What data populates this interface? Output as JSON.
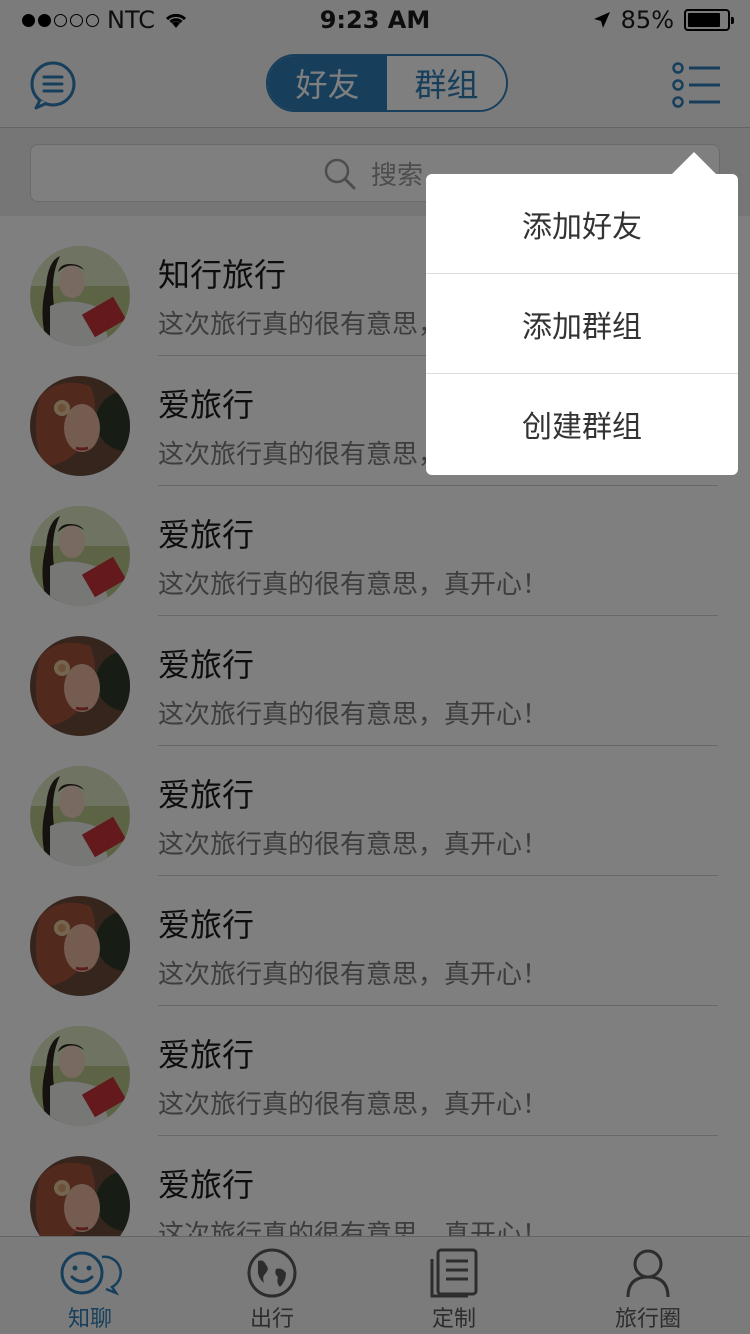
{
  "status_bar": {
    "carrier": "NTC",
    "time": "9:23 AM",
    "battery": "85%",
    "battery_level": 0.85,
    "signal_bars_filled": 2,
    "signal_bars_total": 5
  },
  "nav": {
    "left_icon": "menu-list-icon",
    "right_icon": "list-options-icon",
    "segments": [
      {
        "label": "好友",
        "active": true
      },
      {
        "label": "群组",
        "active": false
      }
    ]
  },
  "search": {
    "placeholder": "搜索"
  },
  "chats": [
    {
      "name": "知行旅行",
      "message": "这次旅行真的很有意思，真开心！",
      "avatar": "girl-book"
    },
    {
      "name": "爱旅行",
      "message": "这次旅行真的很有意思，真开心！",
      "avatar": "girl-flower"
    },
    {
      "name": "爱旅行",
      "message": "这次旅行真的很有意思，真开心！",
      "avatar": "girl-book"
    },
    {
      "name": "爱旅行",
      "message": "这次旅行真的很有意思，真开心！",
      "avatar": "girl-flower"
    },
    {
      "name": "爱旅行",
      "message": "这次旅行真的很有意思，真开心！",
      "avatar": "girl-book"
    },
    {
      "name": "爱旅行",
      "message": "这次旅行真的很有意思，真开心！",
      "avatar": "girl-flower"
    },
    {
      "name": "爱旅行",
      "message": "这次旅行真的很有意思，真开心！",
      "avatar": "girl-book"
    },
    {
      "name": "爱旅行",
      "message": "这次旅行真的很有意思，真开心！",
      "avatar": "girl-flower"
    }
  ],
  "popup_menu": {
    "items": [
      "添加好友",
      "添加群组",
      "创建群组"
    ]
  },
  "tab_bar": {
    "tabs": [
      {
        "label": "知聊",
        "icon": "chat-smile-icon",
        "active": true
      },
      {
        "label": "出行",
        "icon": "globe-icon",
        "active": false
      },
      {
        "label": "定制",
        "icon": "document-icon",
        "active": false
      },
      {
        "label": "旅行圈",
        "icon": "person-icon",
        "active": false
      }
    ]
  },
  "colors": {
    "accent": "#2f7fb8",
    "overlay": "rgba(0,0,0,0.5)"
  }
}
